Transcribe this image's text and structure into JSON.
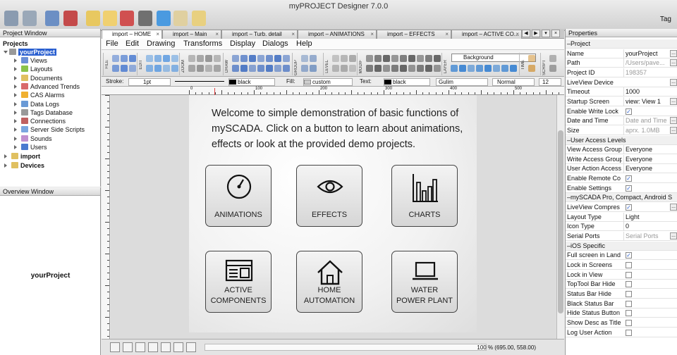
{
  "window": {
    "title": "myPROJECT Designer 7.0.0",
    "tag_button": "Tag"
  },
  "project_window": {
    "title": "Project Window",
    "root": "Projects",
    "project": "yourProject",
    "items": [
      "Views",
      "Layouts",
      "Documents",
      "Advanced Trends",
      "CAS Alarms",
      "Data Logs",
      "Tags Database",
      "Connections",
      "Server Side Scripts",
      "Sounds",
      "Users"
    ],
    "other": [
      "import",
      "Devices"
    ]
  },
  "overview_window": {
    "title": "Overview Window",
    "label": "yourProject"
  },
  "tabs": [
    {
      "label": "import – HOME",
      "active": true
    },
    {
      "label": "import – Main",
      "active": false
    },
    {
      "label": "import – Turb. detail",
      "active": false
    },
    {
      "label": "import – ANIMATIONS",
      "active": false
    },
    {
      "label": "import – EFFECTS",
      "active": false
    },
    {
      "label": "import – ACTIVE CO...",
      "active": false
    }
  ],
  "menu": [
    "File",
    "Edit",
    "Drawing",
    "Transforms",
    "Display",
    "Dialogs",
    "Help"
  ],
  "toolbar_groups": [
    "FILE",
    "EDIT",
    "ZOOM",
    "DRAW",
    "GROUP",
    "LEVEL",
    "MODIF",
    "LAYER",
    "TIME",
    "SCRIPT"
  ],
  "layer_value": "Background",
  "stylebar": {
    "stroke_label": "Stroke:",
    "stroke_width": "1pt",
    "stroke_color": "black",
    "fill_label": "Fill:",
    "fill_value": "custom",
    "text_label": "Text:",
    "text_color": "black",
    "font": "Gulim",
    "weight": "Normal",
    "size": "12"
  },
  "ruler_marks": [
    "0",
    "100",
    "200",
    "300",
    "400",
    "500",
    "600"
  ],
  "screen": {
    "welcome": "Welcome to simple demonstration of basic functions of mySCADA. Click on a button to learn about animations, effects or look at the provided demo projects.",
    "buttons": [
      {
        "line1": "ANIMATIONS",
        "line2": "",
        "icon": "gauge-icon"
      },
      {
        "line1": "EFFECTS",
        "line2": "",
        "icon": "eye-icon"
      },
      {
        "line1": "CHARTS",
        "line2": "",
        "icon": "bar-chart-icon"
      },
      {
        "line1": "ACTIVE",
        "line2": "COMPONENTS",
        "icon": "window-icon"
      },
      {
        "line1": "HOME",
        "line2": "AUTOMATION",
        "icon": "house-icon"
      },
      {
        "line1": "WATER",
        "line2": "POWER PLANT",
        "icon": "laptop-icon"
      }
    ]
  },
  "statusbar": {
    "zoom": "100 % (695.00, 558.00)"
  },
  "properties": {
    "title": "Properties",
    "rows": [
      {
        "type": "section",
        "key": "Project"
      },
      {
        "key": "Name",
        "value": "yourProject",
        "ell": true
      },
      {
        "key": "Path",
        "value": "/Users/pave...",
        "dim": true,
        "ell": true
      },
      {
        "key": "Project ID",
        "value": "198357",
        "dim": true
      },
      {
        "key": "LiveView Device",
        "value": "",
        "ell": true
      },
      {
        "key": "Timeout",
        "value": "1000"
      },
      {
        "key": "Startup Screen",
        "value": "view: View 1",
        "ell": true
      },
      {
        "key": "Enable Write Lock",
        "check": true
      },
      {
        "key": "Date and Time",
        "value": "Date and Time",
        "dim": true,
        "ell": true
      },
      {
        "key": "Size",
        "value": "aprx. 1.0MB",
        "dim": true,
        "ell": true
      },
      {
        "type": "section",
        "key": "User Access Levels"
      },
      {
        "key": "View Access Group",
        "value": "Everyone"
      },
      {
        "key": "Write Access Group",
        "value": "Everyone"
      },
      {
        "key": "User Action Access",
        "value": "Everyone"
      },
      {
        "key": "Enable Remote Co",
        "check": true
      },
      {
        "key": "Enable Settings",
        "check": true
      },
      {
        "type": "section",
        "key": "mySCADA Pro, Compact, Android S..."
      },
      {
        "key": "LiveView Compres",
        "check": true,
        "ell": true
      },
      {
        "key": "Layout Type",
        "value": "Light"
      },
      {
        "key": "Icon Type",
        "value": "0"
      },
      {
        "key": "Serial Ports",
        "value": "Serial Ports",
        "dim": true,
        "ell": true
      },
      {
        "type": "section",
        "key": "iOS Specific"
      },
      {
        "key": "Full screen in Land",
        "check": true
      },
      {
        "key": "Lock in Screens",
        "check": false
      },
      {
        "key": "Lock in View",
        "check": false
      },
      {
        "key": "TopTool Bar Hide",
        "check": false
      },
      {
        "key": "Status Bar Hide",
        "check": false
      },
      {
        "key": "Black Status Bar",
        "check": false
      },
      {
        "key": "Hide Status Button",
        "check": false
      },
      {
        "key": "Show Desc as Title",
        "check": false
      },
      {
        "key": "Log User Action",
        "check": false
      }
    ]
  }
}
